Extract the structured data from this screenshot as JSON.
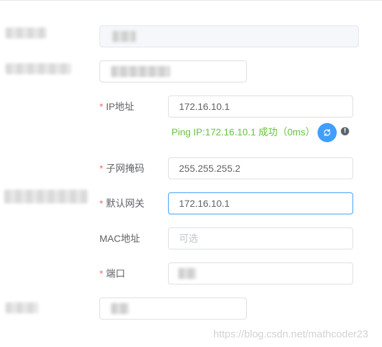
{
  "form": {
    "ip": {
      "label": "IP地址",
      "required_mark": "*",
      "value": "172.16.10.1"
    },
    "ping": {
      "status_text": "Ping IP:172.16.10.1 成功（0ms）",
      "refresh_icon": "refresh-icon",
      "info_icon": "info-icon",
      "info_glyph": "!"
    },
    "subnet_mask": {
      "label": "子网掩码",
      "required_mark": "*",
      "value": "255.255.255.2"
    },
    "gateway": {
      "label": "默认网关",
      "required_mark": "*",
      "value": "172.16.10.1"
    },
    "mac": {
      "label": "MAC地址",
      "value": "",
      "placeholder": "可选"
    },
    "port": {
      "label": "端口",
      "required_mark": "*"
    }
  },
  "watermark": "https://blog.csdn.net/mathcoder23",
  "colors": {
    "required": "#f56c6c",
    "success": "#67c23a",
    "primary": "#409eff",
    "focus_border": "#409eff",
    "border": "#dcdfe6"
  }
}
